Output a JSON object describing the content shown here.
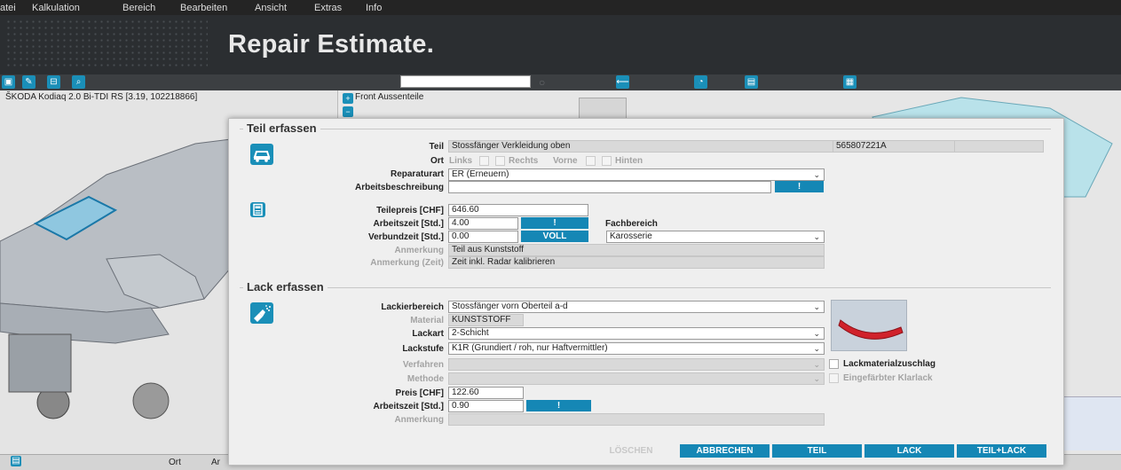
{
  "menu": [
    "atei",
    "Kalkulation",
    "Bereich",
    "Bearbeiten",
    "Ansicht",
    "Extras",
    "Info"
  ],
  "brand": "Repair Estimate.",
  "vehicle": {
    "title": "ŠKODA Kodiaq 2.0 Bi-TDI RS [3.19, 102218866]"
  },
  "parts_panel": {
    "title": "Front Aussenteile"
  },
  "statusbar": {
    "col1": "Ort",
    "col2": "Ar"
  },
  "teil": {
    "legend": "Teil erfassen",
    "teil_label": "Teil",
    "teil_value": "Stossfänger Verkleidung oben",
    "teil_nr": "565807221A",
    "ort_label": "Ort",
    "ort_links": "Links",
    "ort_rechts": "Rechts",
    "ort_vorne": "Vorne",
    "ort_hinten": "Hinten",
    "reparaturart_label": "Reparaturart",
    "reparaturart_value": "ER (Erneuern)",
    "arbeitsbeschreibung_label": "Arbeitsbeschreibung",
    "arbeitsbeschreibung_value": "",
    "excl": "!",
    "teilepreis_label": "Teilepreis [CHF]",
    "teilepreis_value": "646.60",
    "arbeitszeit_label": "Arbeitszeit [Std.]",
    "arbeitszeit_value": "4.00",
    "fachbereich_label": "Fachbereich",
    "verbundzeit_label": "Verbundzeit [Std.]",
    "verbundzeit_value": "0.00",
    "voll": "VOLL",
    "fachbereich_value": "Karosserie",
    "anmerkung_label": "Anmerkung",
    "anmerkung_value": "Teil aus Kunststoff",
    "anmerkung_zeit_label": "Anmerkung (Zeit)",
    "anmerkung_zeit_value": "Zeit inkl. Radar kalibrieren"
  },
  "lack": {
    "legend": "Lack erfassen",
    "lackierbereich_label": "Lackierbereich",
    "lackierbereich_value": "Stossfänger vorn Oberteil a-d",
    "material_label": "Material",
    "material_value": "KUNSTSTOFF",
    "lackart_label": "Lackart",
    "lackart_value": "2-Schicht",
    "lackstufe_label": "Lackstufe",
    "lackstufe_value": "K1R (Grundiert / roh, nur Haftvermittler)",
    "verfahren_label": "Verfahren",
    "lackmaterialzuschlag": "Lackmaterialzuschlag",
    "methode_label": "Methode",
    "eingefaerbter_klarlack": "Eingefärbter Klarlack",
    "preis_label": "Preis [CHF]",
    "preis_value": "122.60",
    "arbeitszeit_label": "Arbeitszeit [Std.]",
    "arbeitszeit_value": "0.90",
    "excl": "!",
    "anmerkung_label": "Anmerkung"
  },
  "footer": {
    "loeschen": "LÖSCHEN",
    "abbrechen": "ABBRECHEN",
    "teil": "TEIL",
    "lack": "LACK",
    "teil_lack": "TEIL+LACK"
  },
  "colors": {
    "accent": "#1587b5",
    "banner": "#2b2e31",
    "part_highlight": "#d0222b"
  },
  "icons": [
    "car-icon",
    "calculator-icon",
    "spray-gun-icon",
    "arrow-left-icon",
    "zoom-in-icon",
    "zoom-out-icon"
  ]
}
